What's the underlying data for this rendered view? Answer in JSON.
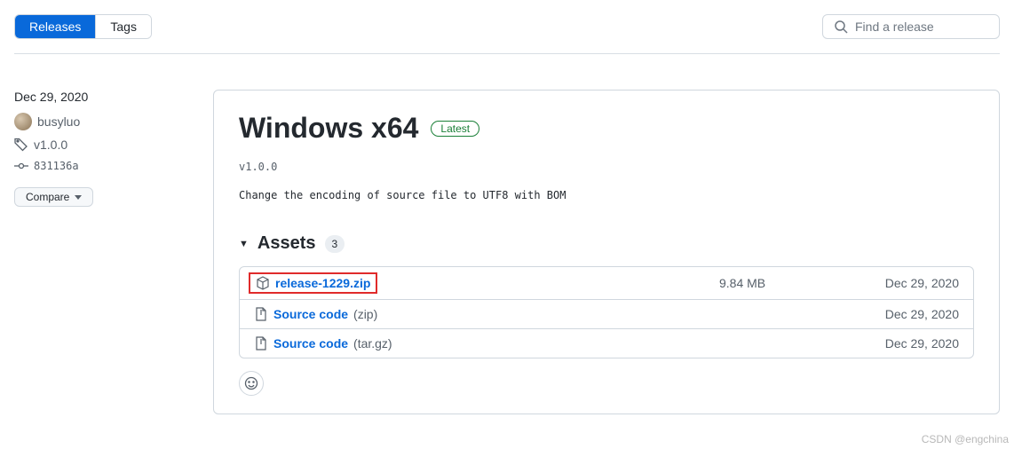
{
  "tabs": {
    "releases": "Releases",
    "tags": "Tags"
  },
  "search": {
    "placeholder": "Find a release"
  },
  "sidebar": {
    "date": "Dec 29, 2020",
    "author": "busyluo",
    "tag": "v1.0.0",
    "commit": "831136a",
    "compare": "Compare"
  },
  "release": {
    "title": "Windows x64",
    "badge": "Latest",
    "version": "v1.0.0",
    "description": "Change the encoding of source file to UTF8 with BOM"
  },
  "assets": {
    "label": "Assets",
    "count": "3",
    "items": [
      {
        "name": "release-1229.zip",
        "ext": "",
        "size": "9.84 MB",
        "date": "Dec 29, 2020",
        "iconType": "package",
        "highlighted": true
      },
      {
        "name": "Source code",
        "ext": "(zip)",
        "size": "",
        "date": "Dec 29, 2020",
        "iconType": "zip",
        "highlighted": false
      },
      {
        "name": "Source code",
        "ext": "(tar.gz)",
        "size": "",
        "date": "Dec 29, 2020",
        "iconType": "zip",
        "highlighted": false
      }
    ]
  },
  "watermark": "CSDN @engchina"
}
